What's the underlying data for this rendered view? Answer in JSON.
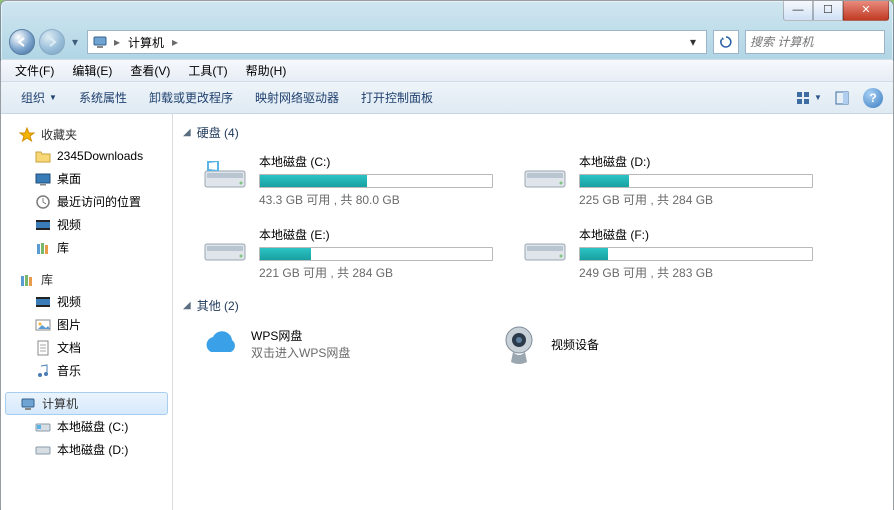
{
  "navigation": {
    "location_label": "计算机",
    "refresh_tooltip": "刷新",
    "search_placeholder": "搜索 计算机"
  },
  "menu": {
    "file": "文件(F)",
    "edit": "编辑(E)",
    "view": "查看(V)",
    "tools": "工具(T)",
    "help": "帮助(H)"
  },
  "commandbar": {
    "organize": "组织",
    "system_properties": "系统属性",
    "uninstall": "卸载或更改程序",
    "map_drive": "映射网络驱动器",
    "control_panel": "打开控制面板"
  },
  "sidebar": {
    "favorites": {
      "label": "收藏夹",
      "items": [
        {
          "label": "2345Downloads",
          "icon": "folder-icon"
        },
        {
          "label": "桌面",
          "icon": "desktop-icon"
        },
        {
          "label": "最近访问的位置",
          "icon": "recent-icon"
        },
        {
          "label": "视频",
          "icon": "video-icon"
        },
        {
          "label": "库",
          "icon": "libraries-icon"
        }
      ]
    },
    "libraries": {
      "label": "库",
      "items": [
        {
          "label": "视频",
          "icon": "video-lib-icon"
        },
        {
          "label": "图片",
          "icon": "pictures-lib-icon"
        },
        {
          "label": "文档",
          "icon": "documents-lib-icon"
        },
        {
          "label": "音乐",
          "icon": "music-lib-icon"
        }
      ]
    },
    "computer": {
      "label": "计算机",
      "items": [
        {
          "label": "本地磁盘 (C:)",
          "icon": "drive-sys-icon"
        },
        {
          "label": "本地磁盘 (D:)",
          "icon": "drive-icon"
        }
      ]
    }
  },
  "main": {
    "drives_group": {
      "label": "硬盘 (4)",
      "drives": [
        {
          "name": "本地磁盘 (C:)",
          "fill_percent": 46,
          "stats": "43.3 GB 可用 , 共 80.0 GB",
          "system": true
        },
        {
          "name": "本地磁盘 (D:)",
          "fill_percent": 21,
          "stats": "225 GB 可用 , 共 284 GB",
          "system": false
        },
        {
          "name": "本地磁盘 (E:)",
          "fill_percent": 22,
          "stats": "221 GB 可用 , 共 284 GB",
          "system": false
        },
        {
          "name": "本地磁盘 (F:)",
          "fill_percent": 12,
          "stats": "249 GB 可用 , 共 283 GB",
          "system": false
        }
      ]
    },
    "other_group": {
      "label": "其他 (2)",
      "items": [
        {
          "name": "WPS网盘",
          "sub": "双击进入WPS网盘",
          "icon": "cloud-icon"
        },
        {
          "name": "视频设备",
          "sub": "",
          "icon": "webcam-icon"
        }
      ]
    }
  }
}
